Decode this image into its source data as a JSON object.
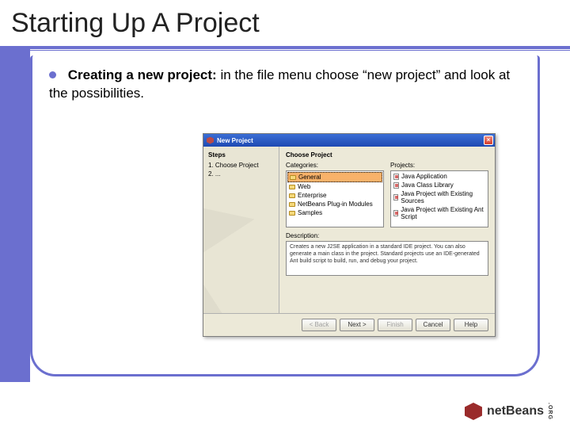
{
  "slide": {
    "title": "Starting Up A Project",
    "bullet_bold": "Creating a new project:",
    "bullet_rest": " in the file menu choose “new project” and look at the possibilities."
  },
  "dialog": {
    "title": "New Project",
    "steps_heading": "Steps",
    "steps": [
      "1.  Choose Project",
      "2.  ..."
    ],
    "right_heading": "Choose Project",
    "categories_label": "Categories:",
    "projects_label": "Projects:",
    "categories": [
      {
        "label": "General",
        "selected": true
      },
      {
        "label": "Web",
        "selected": false
      },
      {
        "label": "Enterprise",
        "selected": false
      },
      {
        "label": "NetBeans Plug-in Modules",
        "selected": false
      },
      {
        "label": "Samples",
        "selected": false
      }
    ],
    "projects": [
      {
        "label": "Java Application"
      },
      {
        "label": "Java Class Library"
      },
      {
        "label": "Java Project with Existing Sources"
      },
      {
        "label": "Java Project with Existing Ant Script"
      }
    ],
    "description_label": "Description:",
    "description_text": "Creates a new J2SE application in a standard IDE project. You can also generate a main class in the project. Standard projects use an IDE-generated Ant build script to build, run, and debug your project.",
    "buttons": {
      "back": "< Back",
      "next": "Next >",
      "finish": "Finish",
      "cancel": "Cancel",
      "help": "Help"
    }
  },
  "logo": {
    "brand": "netBeans",
    "suffix": ".ORG"
  }
}
